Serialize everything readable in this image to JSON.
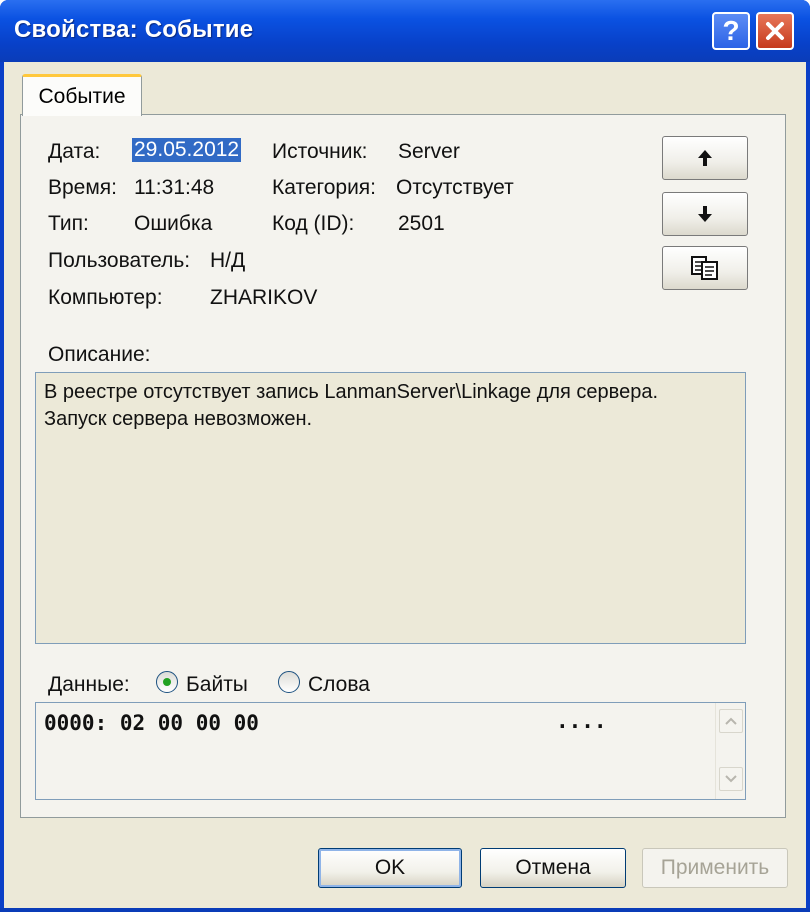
{
  "window": {
    "title": "Свойства: Событие",
    "help_label": "?",
    "close_label": "×"
  },
  "tab": {
    "label": "Событие"
  },
  "fields": {
    "date_label": "Дата:",
    "date_value": "29.05.2012",
    "time_label": "Время:",
    "time_value": "11:31:48",
    "type_label": "Тип:",
    "type_value": "Ошибка",
    "user_label": "Пользователь:",
    "user_value": "Н/Д",
    "computer_label": "Компьютер:",
    "computer_value": "ZHARIKOV",
    "source_label": "Источник:",
    "source_value": "Server",
    "category_label": "Категория:",
    "category_value": "Отсутствует",
    "id_label": "Код (ID):",
    "id_value": "2501"
  },
  "side_buttons": {
    "up_icon": "arrow-up-icon",
    "down_icon": "arrow-down-icon",
    "copy_icon": "copy-icon"
  },
  "description": {
    "label": "Описание:",
    "line1": "В реестре отсутствует запись LanmanServer\\Linkage для сервера.",
    "line2": "Запуск сервера невозможен."
  },
  "data_section": {
    "label": "Данные:",
    "radio_bytes": "Байты",
    "radio_words": "Слова",
    "selected": "Байты",
    "line": "0000: 02 00 00 00",
    "ascii": "...."
  },
  "buttons": {
    "ok": "OK",
    "cancel": "Отмена",
    "apply": "Применить"
  },
  "colors": {
    "titlebar": "#0b52e2",
    "selection": "#316ac5",
    "radio_dot": "#21a121",
    "tab_accent": "#ffc83c"
  }
}
